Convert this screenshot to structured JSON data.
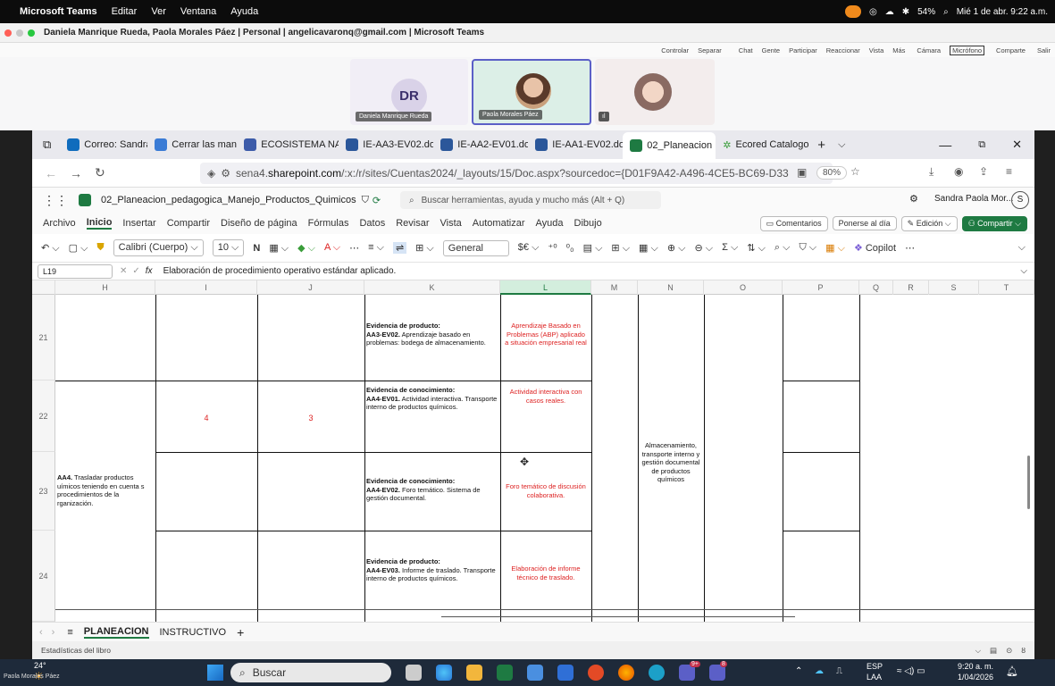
{
  "mac": {
    "app": "Microsoft Teams",
    "menus": [
      "Editar",
      "Ver",
      "Ventana",
      "Ayuda"
    ],
    "battery": "54%",
    "datetime": "Mié 1 de abr. 9:22 a.m."
  },
  "teams": {
    "title": "Daniela Manrique Rueda, Paola Morales Páez | Personal | angelicavaronq@gmail.com | Microsoft Teams",
    "controls": [
      "Controlar",
      "Separar",
      "Chat",
      "Gente",
      "Participar",
      "Reaccionar",
      "Vista",
      "Más",
      "Cámara",
      "Micrófono",
      "Comparte",
      "Salir"
    ],
    "participants": [
      {
        "initials": "DR",
        "name": "Daniela Manrique Rueda"
      },
      {
        "name": "Paola Morales Páez"
      }
    ],
    "self_label": "Paola Morales Páez"
  },
  "browser": {
    "tabs": [
      "Correo: Sandra P",
      "Cerrar las manos",
      "ECOSISTEMA NA",
      "IE-AA3-EV02.doc",
      "IE-AA2-EV01.doc",
      "IE-AA1-EV02.doc",
      "02_Planeacion",
      "Ecored Catalogo"
    ],
    "url_pre": "sena4.",
    "url_host": "sharepoint.com",
    "url_rest": "/:x:/r/sites/Cuentas2024/_layouts/15/Doc.aspx?sourcedoc={D01F9A42-A496-4CE5-BC69-D33",
    "zoom": "80%"
  },
  "excel": {
    "filename": "02_Planeacion_pedagogica_Manejo_Productos_Quimicos",
    "search_placeholder": "Buscar herramientas, ayuda y mucho más (Alt + Q)",
    "user": "Sandra Paola Mor...",
    "user_initial": "S",
    "ribbon_tabs": [
      "Archivo",
      "Inicio",
      "Insertar",
      "Compartir",
      "Diseño de página",
      "Fórmulas",
      "Datos",
      "Revisar",
      "Vista",
      "Automatizar",
      "Ayuda",
      "Dibujo"
    ],
    "ribbon_buttons": {
      "comments": "Comentarios",
      "meeting": "Ponerse al día",
      "edit": "Edición",
      "share": "Compartir"
    },
    "font": "Calibri (Cuerpo)",
    "font_size": "10",
    "number_format": "General",
    "copilot": "Copilot",
    "cell_ref": "L19",
    "formula": "Elaboración de procedimiento operativo estándar aplicado.",
    "columns": [
      "H",
      "I",
      "J",
      "K",
      "L",
      "M",
      "N",
      "O",
      "P",
      "Q",
      "R",
      "S",
      "T"
    ],
    "rows": [
      "21",
      "22",
      "23",
      "24"
    ],
    "cells": {
      "k21_title": "Evidencia de producto:",
      "k21_code": "AA3-EV02.",
      "k21_text": " Aprendizaje basado en problemas: bodega de almacenamiento.",
      "l21": "Aprendizaje Basado en Problemas (ABP) aplicado a situación empresarial real",
      "i22": "4",
      "j22": "3",
      "k22_title": "Evidencia de conocimiento:",
      "k22_code": "AA4-EV01.",
      "k22_text": " Actividad interactiva. Transporte interno de productos químicos.",
      "l22": "Actividad interactiva con casos reales.",
      "h23_code": "AA4.",
      "h23_text": " Trasladar productos uímicos teniendo en cuenta s procedimientos de la rganización.",
      "k23_title": "Evidencia de conocimiento:",
      "k23_code": "AA4-EV02.",
      "k23_text": " Foro temático. Sistema de gestión documental.",
      "l23": "Foro temático de discusión colaborativa.",
      "n_merged": "Almacenamiento, transporte interno y gestión documental de productos químicos",
      "k24_title": "Evidencia de producto:",
      "k24_code": "AA4-EV03.",
      "k24_text": " Informe de traslado. Transporte interno de productos químicos.",
      "l24": "Elaboración de informe técnico de traslado."
    },
    "sheets": [
      "PLANEACION",
      "INSTRUCTIVO"
    ],
    "status": "Estadísticas del libro"
  },
  "taskbar": {
    "weather": "24°",
    "search": "Buscar",
    "lang": "ESP",
    "lang2": "LAA",
    "time": "9:20 a. m.",
    "date": "1/04/2026",
    "badge1": "9+",
    "badge2": "8"
  }
}
